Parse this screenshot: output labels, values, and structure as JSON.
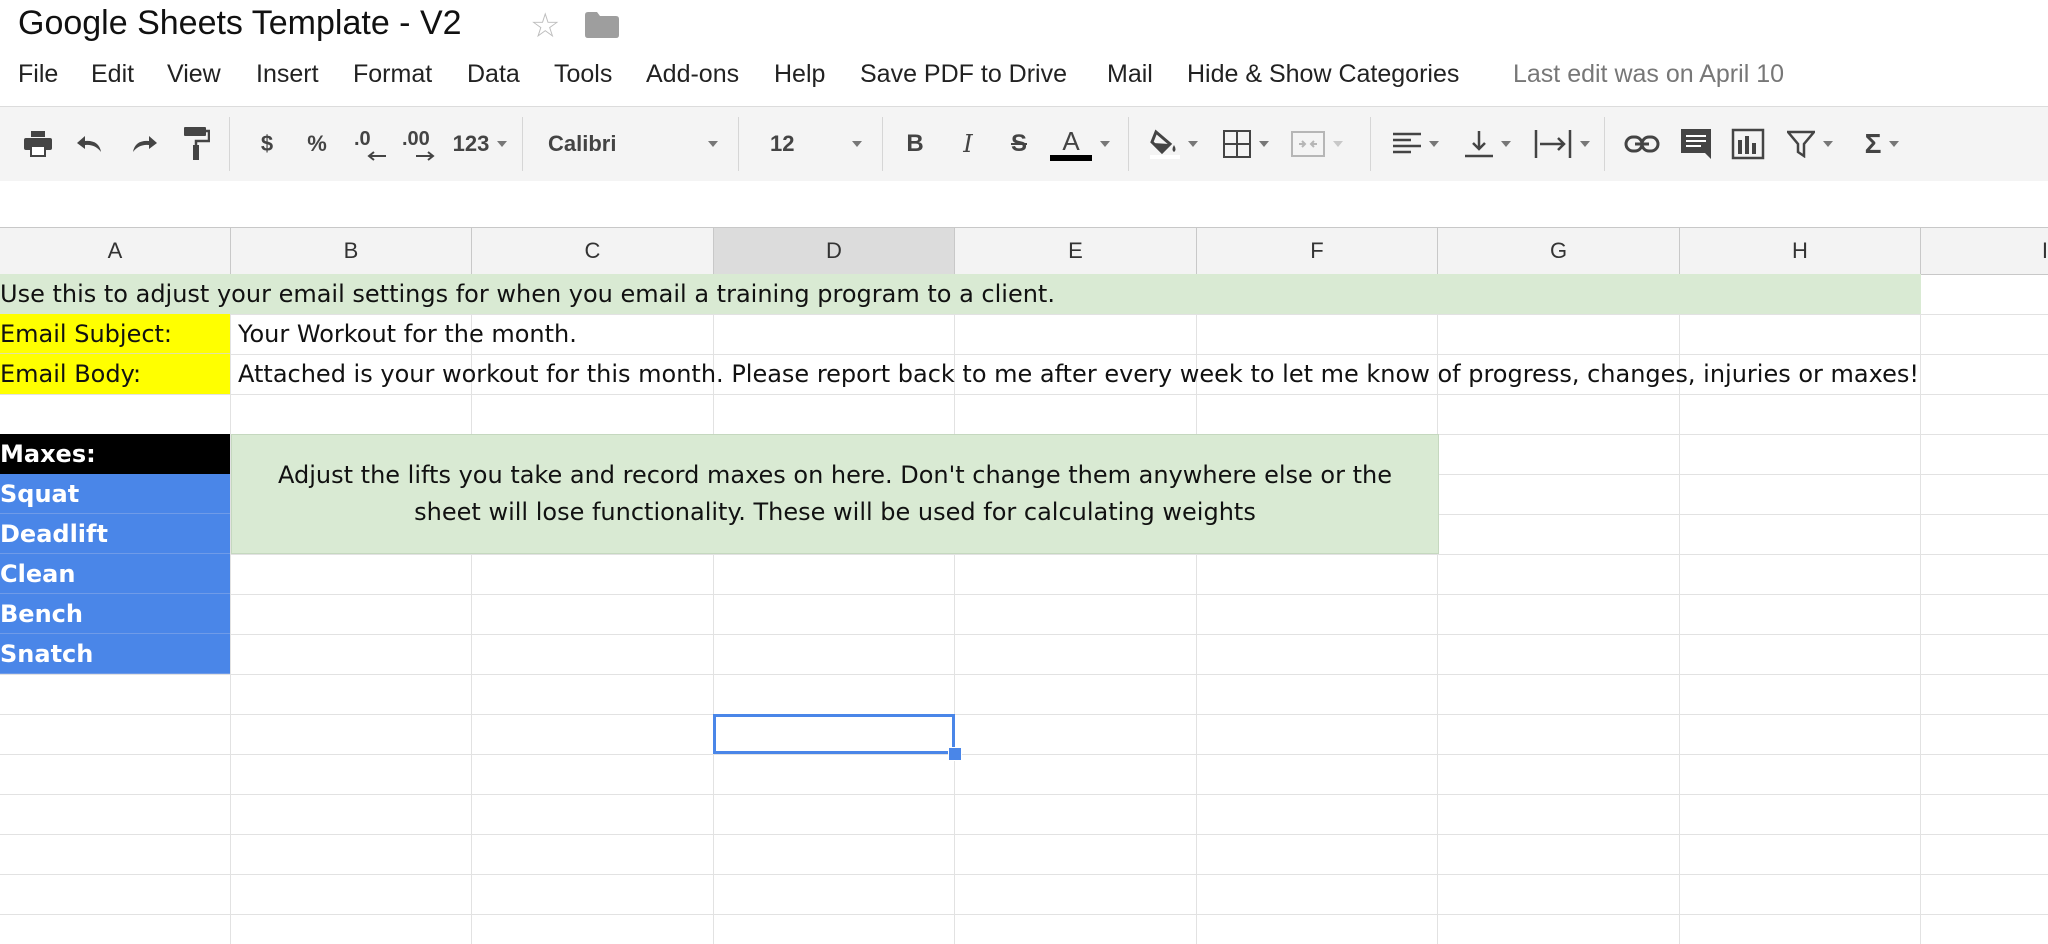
{
  "title": "Google Sheets Template - V2",
  "icons": {
    "star": "star-icon",
    "folder": "folder-icon"
  },
  "menu": {
    "items": [
      "File",
      "Edit",
      "View",
      "Insert",
      "Format",
      "Data",
      "Tools",
      "Add-ons",
      "Help",
      "Save PDF to Drive",
      "Mail",
      "Hide & Show Categories"
    ],
    "last_edit": "Last edit was on April 10"
  },
  "toolbar": {
    "currency": "$",
    "percent": "%",
    "dec_decrease": ".0",
    "dec_increase": ".00",
    "more_formats": "123",
    "font_family": "Calibri",
    "font_size": "12",
    "bold": "B",
    "italic": "I",
    "strikethrough": "S",
    "text_color_label": "A",
    "function_symbol": "Σ"
  },
  "columns": [
    "A",
    "B",
    "C",
    "D",
    "E",
    "F",
    "G",
    "H",
    "I"
  ],
  "active_column": "D",
  "sheet": {
    "banner": "Use this to adjust your email settings for when you email a training program to a client.",
    "email_subject_label": "Email Subject:",
    "email_subject_value": "Your Workout for the month.",
    "email_body_label": "Email Body:",
    "email_body_value": "Attached is your workout for this month. Please report back to me after every week to let me know of progress, changes, injuries or maxes!",
    "maxes_label": "Maxes:",
    "lifts": [
      "Squat",
      "Deadlift",
      "Clean",
      "Bench",
      "Snatch"
    ],
    "note": "Adjust the lifts you take and record maxes on here.  Don't change them anywhere else or the sheet will lose functionality. These will be used for calculating weights"
  },
  "colors": {
    "banner_green": "#d9ead3",
    "label_yellow": "#ffff00",
    "header_black": "#000000",
    "lift_blue": "#4a86e8",
    "selection_blue": "#4a86e8"
  }
}
